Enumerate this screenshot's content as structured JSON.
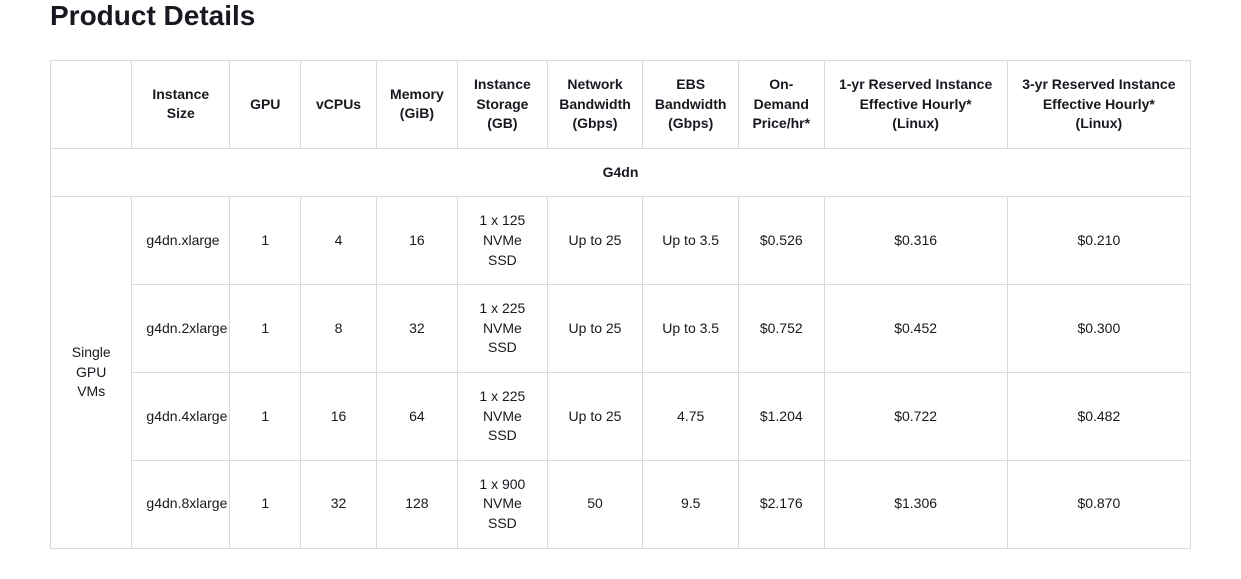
{
  "title": "Product Details",
  "columns": [
    "",
    "Instance Size",
    "GPU",
    "vCPUs",
    "Memory (GiB)",
    "Instance Storage (GB)",
    "Network Bandwidth (Gbps)",
    "EBS Bandwidth (Gbps)",
    "On-Demand Price/hr*",
    "1-yr Reserved Instance Effective Hourly* (Linux)",
    "3-yr Reserved Instance Effective Hourly* (Linux)"
  ],
  "group_label": "G4dn",
  "row_group_label": "Single GPU VMs",
  "rows": [
    {
      "size": "g4dn.xlarge",
      "gpu": "1",
      "vcpus": "4",
      "memory": "16",
      "storage": "1 x 125 NVMe SSD",
      "network": "Up to 25",
      "ebs": "Up to 3.5",
      "ondemand": "$0.526",
      "reserved1": "$0.316",
      "reserved3": "$0.210"
    },
    {
      "size": "g4dn.2xlarge",
      "gpu": "1",
      "vcpus": "8",
      "memory": "32",
      "storage": "1 x 225 NVMe SSD",
      "network": "Up to 25",
      "ebs": "Up to 3.5",
      "ondemand": "$0.752",
      "reserved1": "$0.452",
      "reserved3": "$0.300"
    },
    {
      "size": "g4dn.4xlarge",
      "gpu": "1",
      "vcpus": "16",
      "memory": "64",
      "storage": "1 x 225 NVMe SSD",
      "network": "Up to 25",
      "ebs": "4.75",
      "ondemand": "$1.204",
      "reserved1": "$0.722",
      "reserved3": "$0.482"
    },
    {
      "size": "g4dn.8xlarge",
      "gpu": "1",
      "vcpus": "32",
      "memory": "128",
      "storage": "1 x 900 NVMe SSD",
      "network": "50",
      "ebs": "9.5",
      "ondemand": "$2.176",
      "reserved1": "$1.306",
      "reserved3": "$0.870"
    }
  ]
}
